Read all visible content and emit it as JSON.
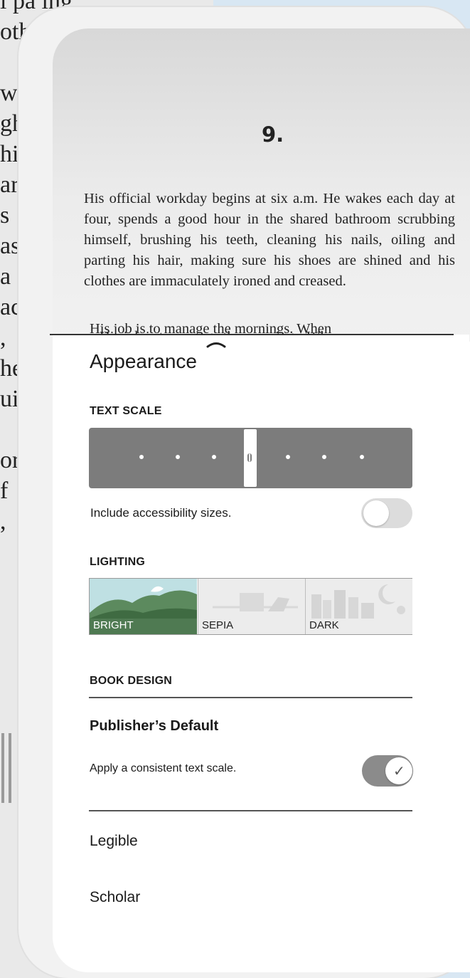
{
  "background_page": {
    "fragments": [
      "l pa  ing",
      "oth",
      "",
      "wa",
      "gh",
      "hi",
      "ar",
      "s",
      "as",
      "a",
      "ac",
      ",",
      "he",
      "ui",
      "",
      "or",
      "f",
      ",",
      ""
    ]
  },
  "book": {
    "chapter_number": "9.",
    "paragraph": "His official workday begins at six a.m. He wakes each day at four, spends a good hour in the shared bathroom scrubbing himself, brushing his teeth, cleaning his nails, oiling and parting his hair, making sure his shoes are shined and his clothes are immaculately ironed and creased.",
    "next_line": "His job is to manage the mornings. When"
  },
  "appearance": {
    "title": "Appearance",
    "text_scale": {
      "heading": "TEXT SCALE",
      "steps": 8,
      "selected_index": 3
    },
    "accessibility": {
      "label": "Include accessibility sizes.",
      "enabled": false
    },
    "lighting": {
      "heading": "LIGHTING",
      "options": [
        {
          "label": "BRIGHT",
          "selected": true
        },
        {
          "label": "SEPIA",
          "selected": false
        },
        {
          "label": "DARK",
          "selected": false
        }
      ]
    },
    "book_design": {
      "heading": "BOOK DESIGN",
      "selected_option": "Publisher’s Default",
      "consistent_scale_label": "Apply a consistent text scale.",
      "consistent_scale_enabled": true,
      "other_options": [
        "Legible",
        "Scholar"
      ]
    }
  },
  "colors": {
    "slider_track": "#7c7c7c",
    "bright_selected": "#4f7a52",
    "toggle_on": "#8b8b8b"
  },
  "icons": [
    "chevron-up-icon",
    "checkmark-icon",
    "grip-icon"
  ]
}
